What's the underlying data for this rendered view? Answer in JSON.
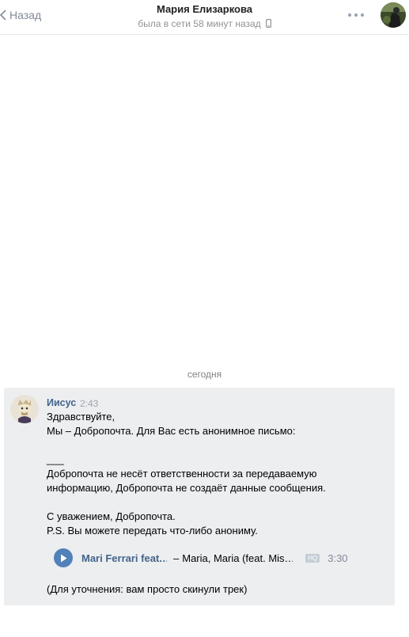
{
  "header": {
    "back_label": "Назад",
    "title": "Мария Елизаркова",
    "status": "была в сети 58 минут назад"
  },
  "date_separator": "сегодня",
  "message": {
    "author": "Иисус",
    "time": "2:43",
    "lines": [
      "Здравствуйте,",
      "Мы – Добропочта. Для Вас есть анонимное письмо:",
      "",
      "___",
      "Добропочта не несёт ответственности за передаваемую",
      "информацию, Добропочта не создаёт данные сообщения.",
      "",
      "С уважением, Добропочта.",
      "P.S. Вы можете передать что-либо анониму."
    ],
    "audio": {
      "artist": "Mari Ferrari feat.…",
      "separator": "–",
      "title": "Maria, Maria (feat. Mis…",
      "quality_badge": "HQ",
      "duration": "3:30"
    },
    "footer": "(Для уточнения: вам просто скинули трек)"
  },
  "colors": {
    "link": "#42648b",
    "accent": "#5181b8",
    "message_bg": "#edeef0",
    "muted": "#939393"
  },
  "icons": [
    "chevron-left-icon",
    "phone-icon",
    "more-icon",
    "play-icon"
  ]
}
